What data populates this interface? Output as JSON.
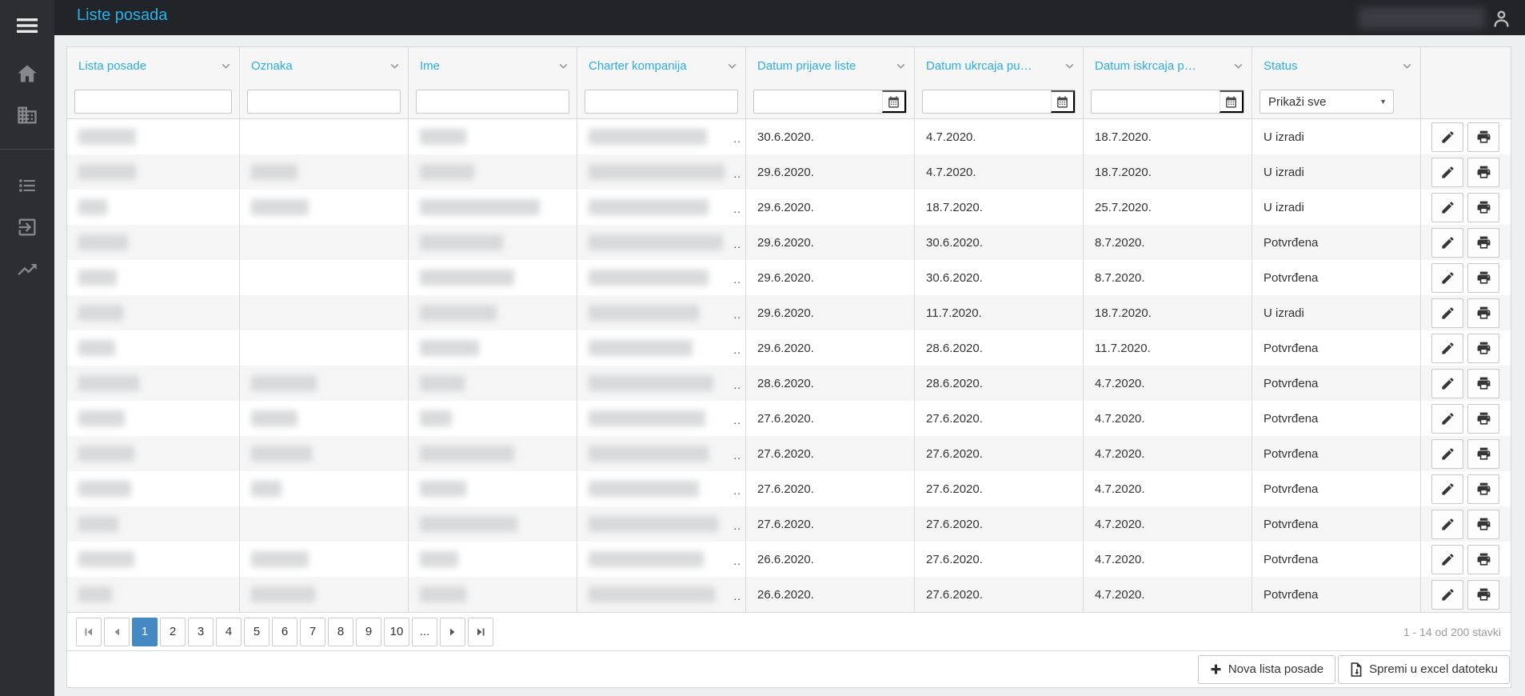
{
  "app": {
    "title": "Liste posada"
  },
  "header": {
    "user_icon": "person-icon",
    "user_name": ""
  },
  "sidebar": {
    "items": [
      {
        "icon": "hamburger-menu-icon"
      },
      {
        "icon": "home-icon"
      },
      {
        "icon": "building-icon"
      },
      {
        "icon": "list-icon"
      },
      {
        "icon": "exit-to-app-icon"
      },
      {
        "icon": "trending-up-icon"
      }
    ]
  },
  "grid": {
    "columns": [
      {
        "label": "Lista posade",
        "filter": "text"
      },
      {
        "label": "Oznaka",
        "filter": "text"
      },
      {
        "label": "Ime",
        "filter": "text"
      },
      {
        "label": "Charter kompanija",
        "filter": "text"
      },
      {
        "label": "Datum prijave liste",
        "filter": "date"
      },
      {
        "label": "Datum ukrcaja pu…",
        "filter": "date"
      },
      {
        "label": "Datum iskrcaja p…",
        "filter": "date"
      },
      {
        "label": "Status",
        "filter": "select",
        "filter_value": "Prikaži sve"
      },
      {
        "label": "",
        "filter": "none"
      }
    ],
    "charter_truncation": "..",
    "rows": [
      {
        "lista_w": 72,
        "oznaka_w": 0,
        "ime_w": 58,
        "charter_w": 148,
        "prijava": "30.6.2020.",
        "ukrcaj": "4.7.2020.",
        "iskrcaj": "18.7.2020.",
        "status": "U izradi"
      },
      {
        "lista_w": 72,
        "oznaka_w": 58,
        "ime_w": 68,
        "charter_w": 170,
        "prijava": "29.6.2020.",
        "ukrcaj": "4.7.2020.",
        "iskrcaj": "18.7.2020.",
        "status": "U izradi"
      },
      {
        "lista_w": 36,
        "oznaka_w": 72,
        "ime_w": 150,
        "charter_w": 150,
        "prijava": "29.6.2020.",
        "ukrcaj": "18.7.2020.",
        "iskrcaj": "25.7.2020.",
        "status": "U izradi"
      },
      {
        "lista_w": 62,
        "oznaka_w": 0,
        "ime_w": 104,
        "charter_w": 168,
        "prijava": "29.6.2020.",
        "ukrcaj": "30.6.2020.",
        "iskrcaj": "8.7.2020.",
        "status": "Potvrđena"
      },
      {
        "lista_w": 48,
        "oznaka_w": 0,
        "ime_w": 118,
        "charter_w": 150,
        "prijava": "29.6.2020.",
        "ukrcaj": "30.6.2020.",
        "iskrcaj": "8.7.2020.",
        "status": "Potvrđena"
      },
      {
        "lista_w": 56,
        "oznaka_w": 0,
        "ime_w": 96,
        "charter_w": 138,
        "prijava": "29.6.2020.",
        "ukrcaj": "11.7.2020.",
        "iskrcaj": "18.7.2020.",
        "status": "U izradi"
      },
      {
        "lista_w": 46,
        "oznaka_w": 0,
        "ime_w": 74,
        "charter_w": 130,
        "prijava": "29.6.2020.",
        "ukrcaj": "28.6.2020.",
        "iskrcaj": "11.7.2020.",
        "status": "Potvrđena"
      },
      {
        "lista_w": 76,
        "oznaka_w": 82,
        "ime_w": 56,
        "charter_w": 156,
        "prijava": "28.6.2020.",
        "ukrcaj": "28.6.2020.",
        "iskrcaj": "4.7.2020.",
        "status": "Potvrđena"
      },
      {
        "lista_w": 58,
        "oznaka_w": 58,
        "ime_w": 40,
        "charter_w": 146,
        "prijava": "27.6.2020.",
        "ukrcaj": "27.6.2020.",
        "iskrcaj": "4.7.2020.",
        "status": "Potvrđena"
      },
      {
        "lista_w": 70,
        "oznaka_w": 76,
        "ime_w": 118,
        "charter_w": 150,
        "prijava": "27.6.2020.",
        "ukrcaj": "27.6.2020.",
        "iskrcaj": "4.7.2020.",
        "status": "Potvrđena"
      },
      {
        "lista_w": 66,
        "oznaka_w": 38,
        "ime_w": 58,
        "charter_w": 138,
        "prijava": "27.6.2020.",
        "ukrcaj": "27.6.2020.",
        "iskrcaj": "4.7.2020.",
        "status": "Potvrđena"
      },
      {
        "lista_w": 50,
        "oznaka_w": 0,
        "ime_w": 122,
        "charter_w": 162,
        "prijava": "27.6.2020.",
        "ukrcaj": "27.6.2020.",
        "iskrcaj": "4.7.2020.",
        "status": "Potvrđena"
      },
      {
        "lista_w": 70,
        "oznaka_w": 72,
        "ime_w": 48,
        "charter_w": 144,
        "prijava": "26.6.2020.",
        "ukrcaj": "27.6.2020.",
        "iskrcaj": "4.7.2020.",
        "status": "Potvrđena"
      },
      {
        "lista_w": 42,
        "oznaka_w": 80,
        "ime_w": 58,
        "charter_w": 158,
        "prijava": "26.6.2020.",
        "ukrcaj": "27.6.2020.",
        "iskrcaj": "4.7.2020.",
        "status": "Potvrđena"
      }
    ],
    "row_actions": [
      {
        "icon": "pencil-icon",
        "name": "edit"
      },
      {
        "icon": "printer-icon",
        "name": "print"
      }
    ]
  },
  "pager": {
    "pages": [
      "1",
      "2",
      "3",
      "4",
      "5",
      "6",
      "7",
      "8",
      "9",
      "10"
    ],
    "ellipsis": "...",
    "active_page": "1",
    "info": "1 - 14 od 200 stavki"
  },
  "footer": {
    "new_list_label": "Nova lista posade",
    "excel_label": "Spremi u excel datoteku"
  },
  "colors": {
    "accent": "#2aaee6",
    "header_bg": "#212529",
    "sidebar_bg": "#2b2e33",
    "pager_active": "#4589c4",
    "alt_row": "#f5f5f5",
    "status_in_progress": "U izradi",
    "status_confirmed": "Potvrđena"
  }
}
